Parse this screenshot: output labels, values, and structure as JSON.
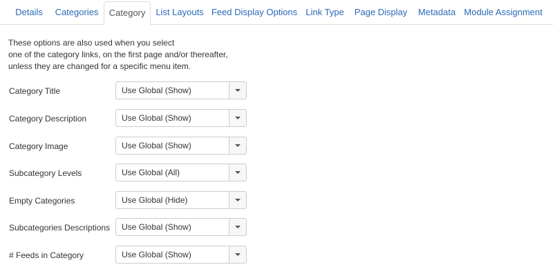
{
  "tabs": [
    {
      "label": "Details"
    },
    {
      "label": "Categories"
    },
    {
      "label": "Category",
      "active": true
    },
    {
      "label": "List Layouts"
    },
    {
      "label": "Feed Display Options"
    },
    {
      "label": "Link Type"
    },
    {
      "label": "Page Display"
    },
    {
      "label": "Metadata"
    },
    {
      "label": "Module Assignment"
    }
  ],
  "intro": {
    "line1": "These options are also used when you select",
    "line2": "one of the category links, on the first page and/or thereafter,",
    "line3": "unless they are changed for a specific menu item."
  },
  "fields": [
    {
      "label": "Category Title",
      "value": "Use Global (Show)"
    },
    {
      "label": "Category Description",
      "value": "Use Global (Show)"
    },
    {
      "label": "Category Image",
      "value": "Use Global (Show)"
    },
    {
      "label": "Subcategory Levels",
      "value": "Use Global (All)"
    },
    {
      "label": "Empty Categories",
      "value": "Use Global (Hide)"
    },
    {
      "label": "Subcategories Descriptions",
      "value": "Use Global (Show)"
    },
    {
      "label": "# Feeds in Category",
      "value": "Use Global (Show)"
    }
  ],
  "colors": {
    "tab_link": "#2a69b8",
    "tab_active_text": "#555555",
    "border": "#cccccc"
  }
}
